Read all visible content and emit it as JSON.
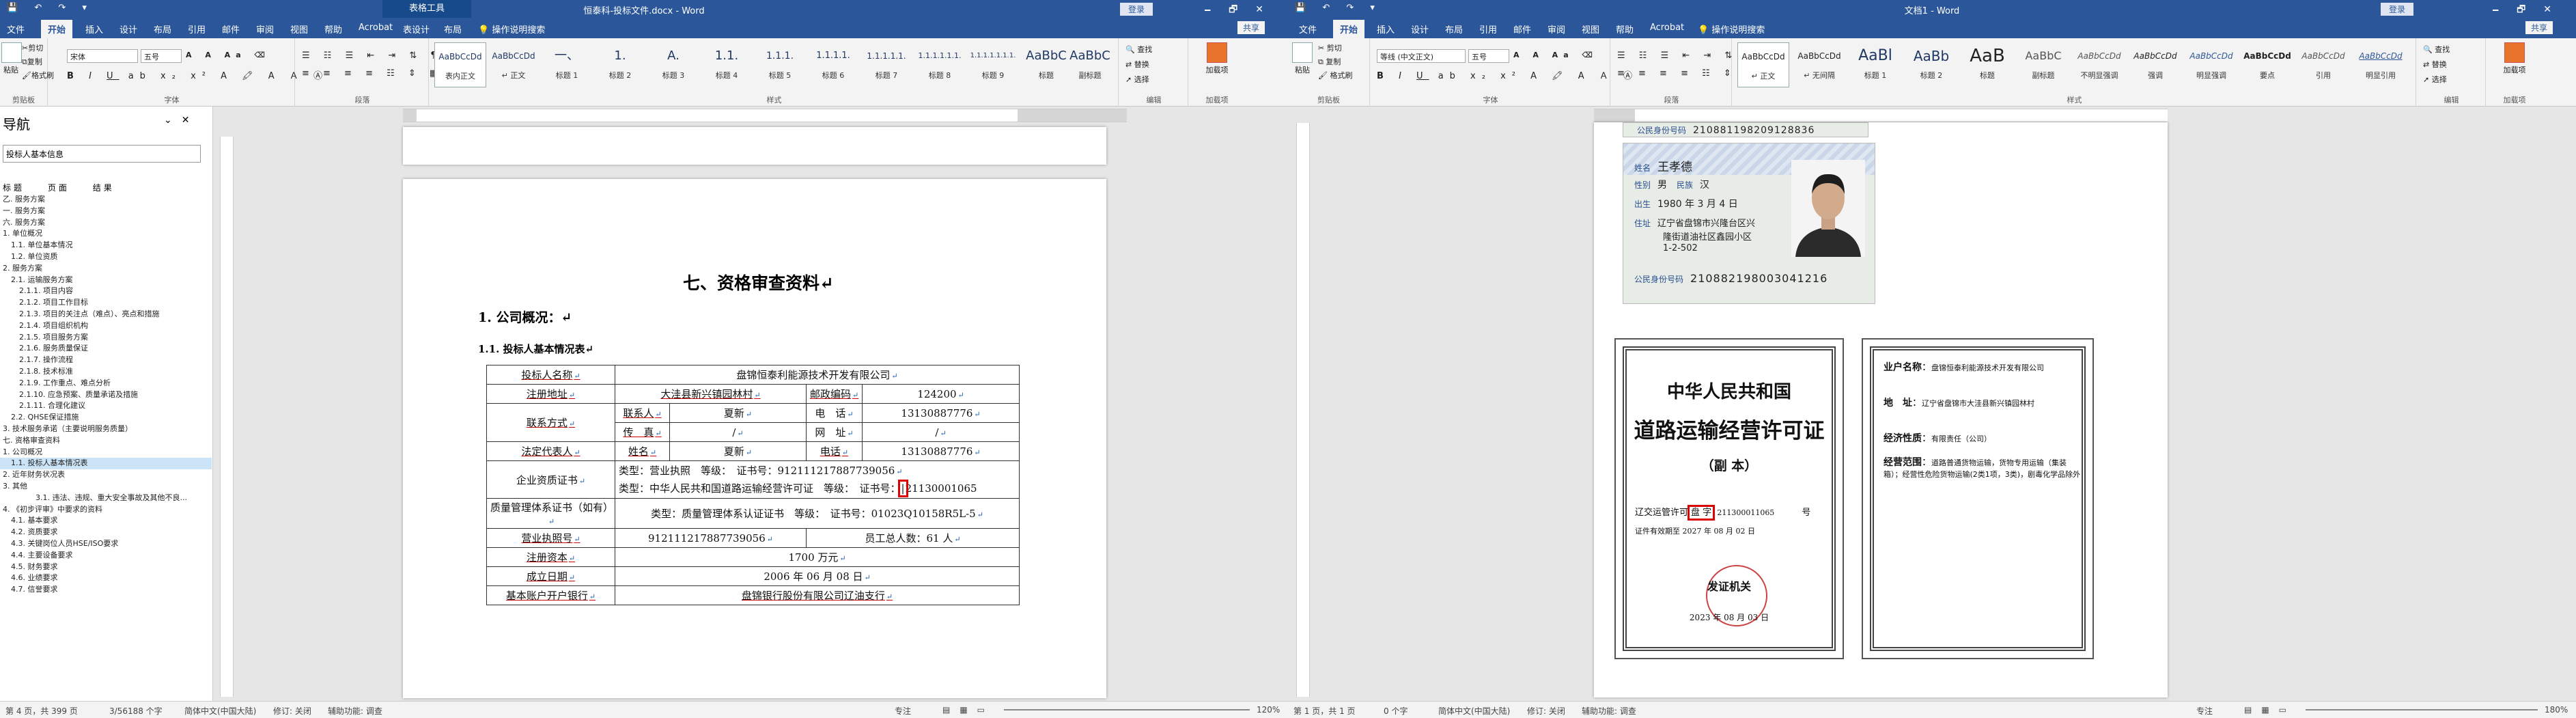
{
  "colors": {
    "word_blue": "#2b579a",
    "highlight_red": "#d00000",
    "status_bg": "#f3f3f3"
  },
  "left": {
    "titlebar": {
      "ctx_tool": "表格工具",
      "doc_title": "恒泰科-投标文件.docx - Word",
      "login": "登录",
      "ctl_icons": "minimize-icon restore-icon close-icon"
    },
    "tabs": [
      "文件",
      "开始",
      "插入",
      "设计",
      "布局",
      "引用",
      "邮件",
      "审阅",
      "视图",
      "帮助",
      "Acrobat",
      "表设计",
      "布局"
    ],
    "tell_me": "操作说明搜索",
    "share": "共享",
    "ribbon": {
      "clipboard": {
        "label": "剪贴板",
        "paste": "粘贴",
        "cut": "剪切",
        "copy": "复制",
        "painter": "格式刷"
      },
      "font": {
        "label": "字体",
        "name": "宋体",
        "size": "五号"
      },
      "paragraph": {
        "label": "段落"
      },
      "styles": {
        "label": "样式",
        "items": [
          {
            "preview": "AaBbCcDd",
            "name": "表内正文"
          },
          {
            "preview": "AaBbCcDd",
            "name": "↵ 正文"
          },
          {
            "preview": "一、",
            "name": "标题 1"
          },
          {
            "preview": "1.",
            "name": "标题 2"
          },
          {
            "preview": "A.",
            "name": "标题 3"
          },
          {
            "preview": "1.1.",
            "name": "标题 4"
          },
          {
            "preview": "1.1.1.",
            "name": "标题 5"
          },
          {
            "preview": "1.1.1.1.",
            "name": "标题 6"
          },
          {
            "preview": "1.1.1.1.1.",
            "name": "标题 7"
          },
          {
            "preview": "1.1.1.1.1.1.",
            "name": "标题 8"
          },
          {
            "preview": "1.1.1.1.1.1.1.",
            "name": "标题 9"
          },
          {
            "preview": "AaBbC",
            "name": "标题"
          },
          {
            "preview": "AaBbC",
            "name": "副标题"
          }
        ]
      },
      "editing": {
        "label": "编辑",
        "find": "查找",
        "replace": "替换",
        "select": "选择"
      },
      "acrobat": {
        "label": "加载项",
        "item": "加载项"
      }
    },
    "nav": {
      "header": "导航",
      "search_value": "投标人基本信息",
      "tabs": [
        "标题",
        "页面",
        "结果"
      ],
      "items": [
        "乙. 服务方案",
        "一. 服务方案",
        "六. 服务方案",
        "1. 单位概况",
        "1.1. 单位基本情况",
        "1.2. 单位资质",
        "2. 服务方案",
        "2.1. 运输服务方案",
        "2.1.1. 项目内容",
        "2.1.2. 项目工作目标",
        "2.1.3. 项目的关注点（难点）、亮点和措施",
        "2.1.4. 项目组织机构",
        "2.1.5. 项目服务方案",
        "2.1.6. 服务质量保证",
        "2.1.7. 操作流程",
        "2.1.8. 技术标准",
        "2.1.9. 工作重点、难点分析",
        "2.1.10. 应急预案、质量承诺及措施",
        "2.1.11. 合理化建议",
        "2.2. QHSE保证措施",
        "3. 技术服务承诺（主要说明服务质量）",
        "七. 资格审查资料",
        "1. 公司概况",
        "1.1. 投标人基本情况表",
        "2. 近年财务状况表",
        "3. 其他",
        "3.1. 违法、违规、重大安全事故及其他不良...",
        "4. 《初步评审》中要求的资料",
        "4.1. 基本要求",
        "4.2. 资质要求",
        "4.3. 关键岗位人员HSE/ISO要求",
        "4.4. 主要设备要求",
        "4.5. 财务要求",
        "4.6. 业绩要求",
        "4.7. 信誉要求"
      ],
      "selected_index": 23
    },
    "doc": {
      "title": "七、资格审查资料↵",
      "h1": "1. 公司概况：↵",
      "h2": "1.1. 投标人基本情况表↵",
      "rows": {
        "company_label": "投标人名称",
        "company": "盘锦恒泰利能源技术开发有限公司",
        "addr_label": "注册地址",
        "addr": "大洼县新兴镇园林村",
        "zip_label": "邮政编码",
        "zip": "124200",
        "contact_label": "联系方式",
        "contact_person_label": "联系人",
        "contact_person": "夏新",
        "tel_label": "电　话",
        "tel": "13130887776",
        "fax_label": "传　真",
        "fax": "/",
        "web_label": "网　址",
        "web": "/",
        "legal_label": "法定代表人",
        "name_label": "姓名",
        "legal_name": "夏新",
        "legal_tel_label": "电话",
        "legal_tel": "13130887776",
        "cert_label": "企业资质证书",
        "cert_line1": "类型：营业执照　等级：　证书号：912111217887739056",
        "cert_line2a": "类型：中华人民共和国道路运输经营许可证　等级：　证书号：",
        "cert_line2b": "21130001065",
        "qms_label": "质量管理体系证书（如有）",
        "qms": "类型：质量管理体系认证证书　等级：　证书号：01023Q10158R5L-5",
        "license_label": "营业执照号",
        "license": "912111217887739056",
        "staff": "员工总人数：61 人",
        "capital_label": "注册资本",
        "capital": "1700 万元",
        "founded_label": "成立日期",
        "founded": "2006 年 06 月 08 日",
        "bank_label": "基本账户开户银行",
        "bank": "盘锦银行股份有限公司辽油支行"
      }
    },
    "status": {
      "page": "第 4 页，共 399 页",
      "words": "3/56188 个字",
      "lang": "简体中文(中国大陆)",
      "track": "修订: 关闭",
      "a11y": "辅助功能: 调查",
      "focus": "专注",
      "zoom": "120%"
    }
  },
  "right": {
    "titlebar": {
      "doc_title": "文档1 - Word",
      "login": "登录"
    },
    "tabs": [
      "文件",
      "开始",
      "插入",
      "设计",
      "布局",
      "引用",
      "邮件",
      "审阅",
      "视图",
      "帮助",
      "Acrobat"
    ],
    "tell_me": "操作说明搜索",
    "share": "共享",
    "ribbon": {
      "clipboard": {
        "label": "剪贴板",
        "paste": "粘贴",
        "cut": "剪切",
        "copy": "复制",
        "painter": "格式刷"
      },
      "font": {
        "label": "字体",
        "name": "等线 (中文正文)",
        "size": "五号"
      },
      "paragraph": {
        "label": "段落"
      },
      "styles": {
        "label": "样式",
        "items": [
          {
            "preview": "AaBbCcDd",
            "name": "↵ 正文"
          },
          {
            "preview": "AaBbCcDd",
            "name": "↵ 无间隔"
          },
          {
            "preview": "AaBl",
            "name": "标题 1"
          },
          {
            "preview": "AaBb",
            "name": "标题 2"
          },
          {
            "preview": "AaB",
            "name": "标题"
          },
          {
            "preview": "AaBbC",
            "name": "副标题"
          },
          {
            "preview": "AaBbCcDd",
            "name": "不明显强调"
          },
          {
            "preview": "AaBbCcDd",
            "name": "强调"
          },
          {
            "preview": "AaBbCcDd",
            "name": "明显强调"
          },
          {
            "preview": "AaBbCcDd",
            "name": "要点"
          },
          {
            "preview": "AaBbCcDd",
            "name": "引用"
          },
          {
            "preview": "AaBbCcDd",
            "name": "明显引用"
          }
        ]
      },
      "editing": {
        "label": "编辑",
        "find": "查找",
        "replace": "替换",
        "select": "选择"
      },
      "acrobat": {
        "label": "加载项",
        "item": "加载项"
      }
    },
    "id_top": {
      "label": "公民身份号码",
      "number": "210881198209128836"
    },
    "id_card": {
      "name_label": "姓名",
      "name": "王孝德",
      "sex_label": "性别",
      "sex": "男",
      "nation_label": "民族",
      "nation": "汉",
      "birth_label": "出生",
      "birth": "1980 年 3 月 4 日",
      "addr_label": "住址",
      "addr1": "辽宁省盘锦市兴隆台区兴",
      "addr2": "隆街道油社区鑫园小区",
      "addr3": "1-2-502",
      "num_label": "公民身份号码",
      "number": "210882198003041216"
    },
    "cert": {
      "country": "中华人民共和国",
      "title": "道路运输经营许可证",
      "copy": "（副 本）",
      "code_label": "辽交运管许可",
      "code_a": "盘",
      "code_b": "字",
      "code_num": "211300011065",
      "code_suffix": "号",
      "valid_label": "证件有效期至",
      "valid": "2027 年 08 月 02 日",
      "issuer": "发证机关",
      "issue_date": "2023 年 08 月 03 日"
    },
    "cert2": {
      "owner_label": "业户名称",
      "owner": "盘锦恒泰利能源技术开发有限公司",
      "addr_label": "地　址",
      "addr": "辽宁省盘锦市大洼县新兴镇园林村",
      "type_label": "经济性质",
      "type": "有限责任（公司）",
      "scope_label": "经营范围",
      "scope": "道路普通货物运输，货物专用运输（集装箱）；经营性危险货物运输(2类1项，3类)，剧毒化学品除外"
    },
    "status": {
      "page": "第 1 页，共 1 页",
      "words": "0 个字",
      "lang": "简体中文(中国大陆)",
      "track": "修订: 关闭",
      "a11y": "辅助功能: 调查",
      "focus": "专注",
      "zoom": "180%"
    }
  }
}
